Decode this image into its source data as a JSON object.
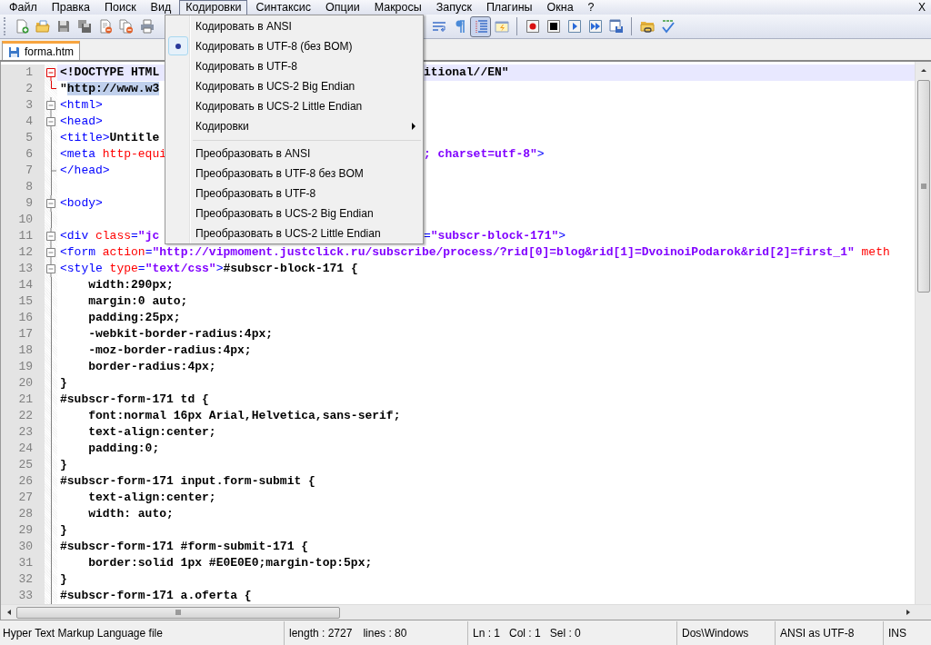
{
  "menu_bar": {
    "items": [
      {
        "label": "Файл",
        "selected": false
      },
      {
        "label": "Правка",
        "selected": false
      },
      {
        "label": "Поиск",
        "selected": false
      },
      {
        "label": "Вид",
        "selected": false
      },
      {
        "label": "Кодировки",
        "selected": true
      },
      {
        "label": "Синтаксис",
        "selected": false
      },
      {
        "label": "Опции",
        "selected": false
      },
      {
        "label": "Макросы",
        "selected": false
      },
      {
        "label": "Запуск",
        "selected": false
      },
      {
        "label": "Плагины",
        "selected": false
      },
      {
        "label": "Окна",
        "selected": false
      },
      {
        "label": "?",
        "selected": false
      }
    ],
    "close_label": "X"
  },
  "toolbar": {
    "left_buttons": [
      {
        "kind": "new"
      },
      {
        "kind": "open"
      },
      {
        "kind": "save"
      },
      {
        "kind": "save-all"
      },
      {
        "kind": "close"
      },
      {
        "kind": "close-all"
      },
      {
        "kind": "print"
      }
    ],
    "right_buttons": [
      {
        "kind": "wrap",
        "pressed": false
      },
      {
        "kind": "pilcrow",
        "pressed": false
      },
      {
        "kind": "indent-guide",
        "pressed": true
      },
      {
        "kind": "panel",
        "pressed": false
      },
      {
        "kind": "separator",
        "pressed": false
      },
      {
        "kind": "record",
        "pressed": false
      },
      {
        "kind": "stop",
        "pressed": false
      },
      {
        "kind": "play",
        "pressed": false
      },
      {
        "kind": "play-multi",
        "pressed": false
      },
      {
        "kind": "save-macro",
        "pressed": false
      },
      {
        "kind": "separator",
        "pressed": false
      },
      {
        "kind": "folder-link",
        "pressed": false
      },
      {
        "kind": "spellcheck",
        "pressed": false
      }
    ]
  },
  "tabs": [
    {
      "label": "forma.htm",
      "selected": true
    }
  ],
  "dropdown": {
    "items": [
      {
        "kind": "radio",
        "label": "Кодировать в ANSI",
        "selected": false
      },
      {
        "kind": "radio",
        "label": "Кодировать в UTF-8 (без BOM)",
        "selected": true
      },
      {
        "kind": "radio",
        "label": "Кодировать в UTF-8",
        "selected": false
      },
      {
        "kind": "radio",
        "label": "Кодировать в UCS-2 Big Endian",
        "selected": false
      },
      {
        "kind": "radio",
        "label": "Кодировать в UCS-2 Little Endian",
        "selected": false
      },
      {
        "kind": "submenu",
        "label": "Кодировки"
      },
      {
        "kind": "separator"
      },
      {
        "kind": "command",
        "label": "Преобразовать в ANSI"
      },
      {
        "kind": "command",
        "label": "Преобразовать в UTF-8 без BOM"
      },
      {
        "kind": "command",
        "label": "Преобразовать в UTF-8"
      },
      {
        "kind": "command",
        "label": "Преобразовать в UCS-2 Big Endian"
      },
      {
        "kind": "command",
        "label": "Преобразовать в UCS-2 Little Endian"
      }
    ]
  },
  "editor": {
    "lines": [
      {
        "number": "1",
        "kind": "open-current",
        "current": true,
        "segments": [
          {
            "kind": "text",
            "text": "<!DOCTYPE HTML"
          }
        ],
        "after_menu": [
          {
            "kind": "text",
            "text": "itional//EN\""
          }
        ]
      },
      {
        "number": "2",
        "kind": "end-current",
        "current": false,
        "segments": [
          {
            "kind": "text",
            "text": "\""
          },
          {
            "kind": "selection",
            "text": "http://www.w3"
          }
        ]
      },
      {
        "number": "3",
        "kind": "open",
        "current": false,
        "segments": [
          {
            "kind": "tag",
            "text": "<html>"
          }
        ]
      },
      {
        "number": "4",
        "kind": "open",
        "current": false,
        "segments": [
          {
            "kind": "tag",
            "text": "<head>"
          }
        ]
      },
      {
        "number": "5",
        "kind": "line",
        "current": false,
        "segments": [
          {
            "kind": "tag",
            "text": "<title>"
          },
          {
            "kind": "text",
            "text": "Untitle"
          }
        ]
      },
      {
        "number": "6",
        "kind": "line",
        "current": false,
        "segments": [
          {
            "kind": "tag",
            "text": "<meta"
          },
          {
            "kind": "attr",
            "text": " http-equi"
          }
        ],
        "after_menu": [
          {
            "kind": "value",
            "text": "; charset=utf-8\""
          },
          {
            "kind": "tag",
            "text": ">"
          }
        ]
      },
      {
        "number": "7",
        "kind": "end",
        "current": false,
        "segments": [
          {
            "kind": "tag",
            "text": "</head>"
          }
        ]
      },
      {
        "number": "8",
        "kind": "line",
        "current": false
      },
      {
        "number": "9",
        "kind": "open",
        "current": false,
        "segments": [
          {
            "kind": "tag",
            "text": "<body>"
          }
        ]
      },
      {
        "number": "10",
        "kind": "line",
        "current": false
      },
      {
        "number": "11",
        "kind": "open",
        "current": false,
        "segments": [
          {
            "kind": "tag",
            "text": "<div"
          },
          {
            "kind": "attr",
            "text": " class"
          },
          {
            "kind": "tag",
            "text": "="
          },
          {
            "kind": "value",
            "text": "\"jc"
          }
        ],
        "after_menu": [
          {
            "kind": "tag",
            "text": "="
          },
          {
            "kind": "value",
            "text": "\"subscr-block-171\""
          },
          {
            "kind": "tag",
            "text": ">"
          }
        ]
      },
      {
        "number": "12",
        "kind": "open",
        "current": false,
        "segments": [
          {
            "kind": "tag",
            "text": "<form"
          },
          {
            "kind": "attr",
            "text": " action"
          },
          {
            "kind": "tag",
            "text": "="
          },
          {
            "kind": "value",
            "text": "\"http://vipmoment.justclick.ru/subscribe/process/?rid[0]=blog&rid[1]=DvoinoiPodarok&rid[2]=first_1\""
          },
          {
            "kind": "attr",
            "text": " meth"
          }
        ]
      },
      {
        "number": "13",
        "kind": "open",
        "current": false,
        "segments": [
          {
            "kind": "tag",
            "text": "<style"
          },
          {
            "kind": "attr",
            "text": " type"
          },
          {
            "kind": "tag",
            "text": "="
          },
          {
            "kind": "value",
            "text": "\"text/css\""
          },
          {
            "kind": "tag",
            "text": ">"
          },
          {
            "kind": "text",
            "text": "#subscr-block-171 {"
          }
        ]
      },
      {
        "number": "14",
        "kind": "line",
        "current": false,
        "segments": [
          {
            "kind": "text",
            "text": "    width:290px;"
          }
        ]
      },
      {
        "number": "15",
        "kind": "line",
        "current": false,
        "segments": [
          {
            "kind": "text",
            "text": "    margin:0 auto;"
          }
        ]
      },
      {
        "number": "16",
        "kind": "line",
        "current": false,
        "segments": [
          {
            "kind": "text",
            "text": "    padding:25px;"
          }
        ]
      },
      {
        "number": "17",
        "kind": "line",
        "current": false,
        "segments": [
          {
            "kind": "text",
            "text": "    -webkit-border-radius:4px;"
          }
        ]
      },
      {
        "number": "18",
        "kind": "line",
        "current": false,
        "segments": [
          {
            "kind": "text",
            "text": "    -moz-border-radius:4px;"
          }
        ]
      },
      {
        "number": "19",
        "kind": "line",
        "current": false,
        "segments": [
          {
            "kind": "text",
            "text": "    border-radius:4px;"
          }
        ]
      },
      {
        "number": "20",
        "kind": "line",
        "current": false,
        "segments": [
          {
            "kind": "text",
            "text": "}"
          }
        ]
      },
      {
        "number": "21",
        "kind": "line",
        "current": false,
        "segments": [
          {
            "kind": "text",
            "text": "#subscr-form-171 td {"
          }
        ]
      },
      {
        "number": "22",
        "kind": "line",
        "current": false,
        "segments": [
          {
            "kind": "text",
            "text": "    font:normal 16px Arial,Helvetica,sans-serif;"
          }
        ]
      },
      {
        "number": "23",
        "kind": "line",
        "current": false,
        "segments": [
          {
            "kind": "text",
            "text": "    text-align:center;"
          }
        ]
      },
      {
        "number": "24",
        "kind": "line",
        "current": false,
        "segments": [
          {
            "kind": "text",
            "text": "    padding:0;"
          }
        ]
      },
      {
        "number": "25",
        "kind": "line",
        "current": false,
        "segments": [
          {
            "kind": "text",
            "text": "}"
          }
        ]
      },
      {
        "number": "26",
        "kind": "line",
        "current": false,
        "segments": [
          {
            "kind": "text",
            "text": "#subscr-form-171 input.form-submit {"
          }
        ]
      },
      {
        "number": "27",
        "kind": "line",
        "current": false,
        "segments": [
          {
            "kind": "text",
            "text": "    text-align:center;"
          }
        ]
      },
      {
        "number": "28",
        "kind": "line",
        "current": false,
        "segments": [
          {
            "kind": "text",
            "text": "    width: auto;"
          }
        ]
      },
      {
        "number": "29",
        "kind": "line",
        "current": false,
        "segments": [
          {
            "kind": "text",
            "text": "}"
          }
        ]
      },
      {
        "number": "30",
        "kind": "line",
        "current": false,
        "segments": [
          {
            "kind": "text",
            "text": "#subscr-form-171 #form-submit-171 {"
          }
        ]
      },
      {
        "number": "31",
        "kind": "line",
        "current": false,
        "segments": [
          {
            "kind": "text",
            "text": "    border:solid 1px #E0E0E0;margin-top:5px;"
          }
        ]
      },
      {
        "number": "32",
        "kind": "line",
        "current": false,
        "segments": [
          {
            "kind": "text",
            "text": "}"
          }
        ]
      },
      {
        "number": "33",
        "kind": "line",
        "current": false,
        "segments": [
          {
            "kind": "text",
            "text": "#subscr-form-171 a.oferta {"
          }
        ]
      }
    ]
  },
  "status_bar": {
    "file_type": "Hyper Text Markup Language file",
    "length": "length : 2727",
    "lines": "lines : 80",
    "ln": "Ln : 1",
    "col": "Col : 1",
    "sel": "Sel : 0",
    "eol": "Dos\\Windows",
    "encoding": "ANSI as UTF-8",
    "mode": "INS"
  }
}
